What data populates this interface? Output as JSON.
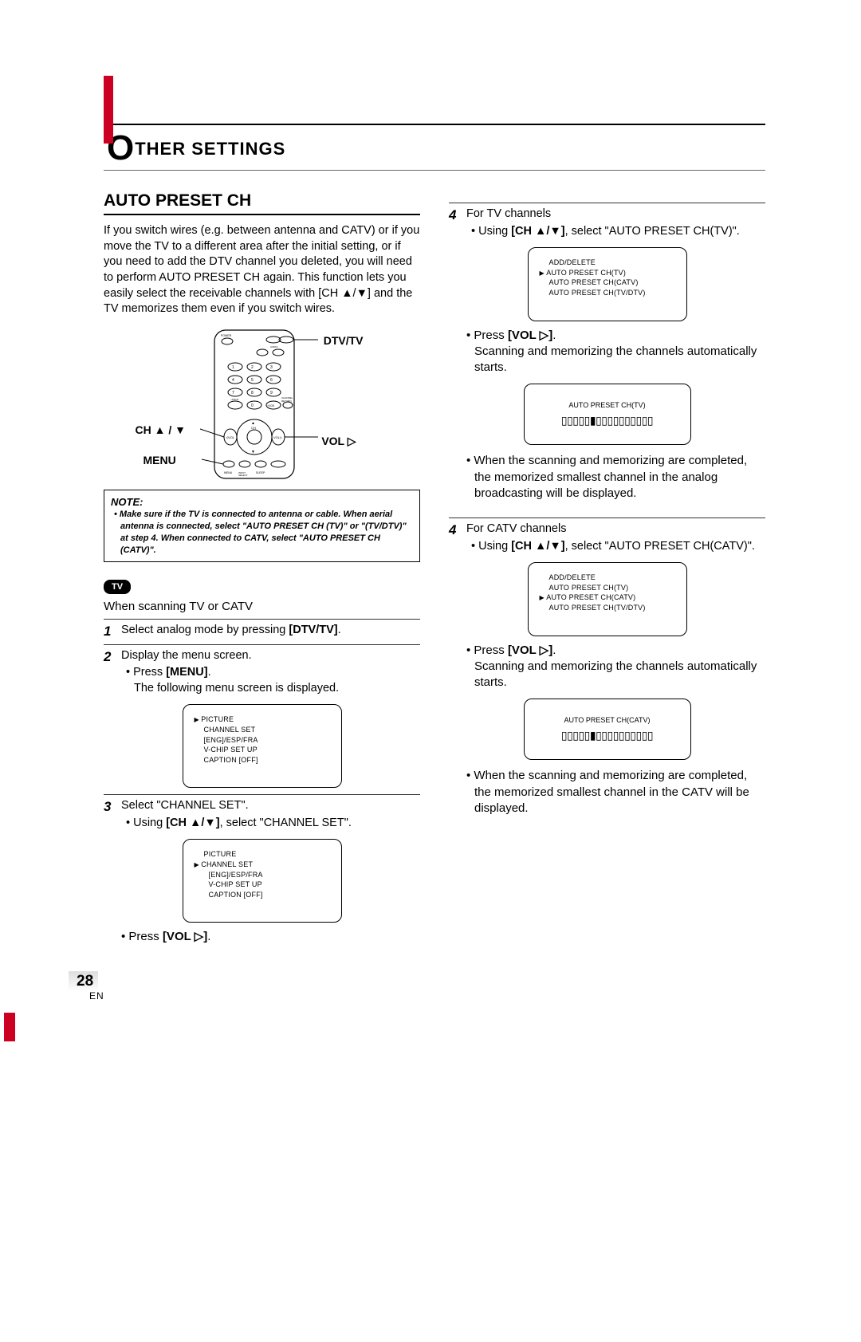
{
  "header": {
    "title_rest": "THER SETTINGS"
  },
  "section_title": "AUTO PRESET CH",
  "intro": "If you switch wires (e.g. between antenna and CATV) or if you move the TV to a different area after the initial setting, or if you need to add the DTV channel you deleted, you will need to perform AUTO PRESET CH again. This function lets you easily select the receivable channels with [CH ▲/▼] and the TV memorizes them even if you switch wires.",
  "remote_labels": {
    "dtvtv": "DTV/TV",
    "vol": "VOL ▷",
    "ch": "CH ▲ / ▼",
    "menu": "MENU"
  },
  "note": {
    "head": "NOTE:",
    "body": "Make sure if the TV is connected to antenna or cable. When aerial antenna is connected, select \"AUTO PRESET CH (TV)\" or \"(TV/DTV)\" at step 4.  When connected to CATV, select \"AUTO PRESET CH (CATV)\"."
  },
  "tv_badge": "TV",
  "scanning_intro": "When scanning TV or CATV",
  "steps_left": {
    "s1": {
      "num": "1",
      "text": "Select analog mode by pressing ",
      "bold": "[DTV/TV]",
      "tail": "."
    },
    "s2": {
      "num": "2",
      "text": "Display the menu screen.",
      "b1a": "Press ",
      "b1b": "[MENU]",
      "b1c": ".",
      "b2": "The following menu screen is displayed."
    },
    "s3": {
      "num": "3",
      "text": "Select \"CHANNEL SET\".",
      "b1a": "Using ",
      "b1b": "[CH ▲/▼]",
      "b1c": ", select \"CHANNEL SET\".",
      "b2a": "Press ",
      "b2b": "[VOL ▷]",
      "b2c": "."
    }
  },
  "menu_screen1": {
    "r0": "PICTURE",
    "r1": "CHANNEL SET",
    "r2": "[ENG]/ESP/FRA",
    "r3": "V-CHIP SET UP",
    "r4": "CAPTION [OFF]"
  },
  "menu_screen2": {
    "r0": "PICTURE",
    "r1": "CHANNEL SET",
    "r2": "[ENG]/ESP/FRA",
    "r3": "V-CHIP SET UP",
    "r4": "CAPTION [OFF]"
  },
  "right": {
    "s4tv": {
      "num": "4",
      "text": "For TV channels",
      "b1a": "Using ",
      "b1b": "[CH ▲/▼]",
      "b1c": ", select \"AUTO PRESET CH(TV)\".",
      "b2a": "Press ",
      "b2b": "[VOL ▷]",
      "b2c": ".",
      "b2d": "Scanning and memorizing the channels automatically starts.",
      "done": "When the scanning and memorizing are completed, the memorized smallest channel in the analog broadcasting will be displayed."
    },
    "s4catv": {
      "num": "4",
      "text": "For CATV channels",
      "b1a": "Using ",
      "b1b": "[CH ▲/▼]",
      "b1c": ", select \"AUTO PRESET CH(CATV)\".",
      "b2a": "Press ",
      "b2b": "[VOL ▷]",
      "b2c": ".",
      "b2d": "Scanning and memorizing the channels automatically starts.",
      "done": "When the scanning and memorizing are completed, the memorized smallest channel in the CATV will be displayed."
    },
    "preset_menu": {
      "r0": "ADD/DELETE",
      "r1": "AUTO PRESET CH(TV)",
      "r2": "AUTO PRESET CH(CATV)",
      "r3": "AUTO PRESET CH(TV/DTV)"
    },
    "progress_tv": "AUTO PRESET CH(TV)",
    "progress_catv": "AUTO PRESET CH(CATV)",
    "progress_bar": "▯▯▯▯▯▮▯▯▯▯▯▯▯▯▯▯"
  },
  "page_number": "28",
  "page_lang": "EN"
}
